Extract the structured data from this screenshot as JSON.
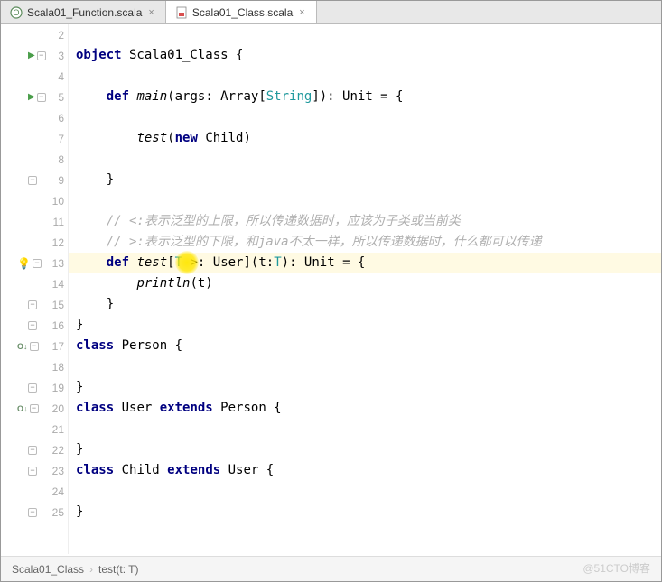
{
  "tabs": [
    {
      "label": "Scala01_Function.scala",
      "active": false
    },
    {
      "label": "Scala01_Class.scala",
      "active": true
    }
  ],
  "code": {
    "l2": "",
    "l3_kw": "object",
    "l3_name": " Scala01_Class {",
    "l4": "",
    "l5_kw1": "def",
    "l5_fn": " main",
    "l5_p1": "(args: Array[",
    "l5_type": "String",
    "l5_p2": "]): Unit = {",
    "l6": "",
    "l7_fn": "test",
    "l7_p1": "(",
    "l7_kw": "new",
    "l7_p2": " Child)",
    "l8": "",
    "l9": "}",
    "l10": "",
    "l11": "// <:表示泛型的上限，所以传递数据时，应该为子类或当前类",
    "l12": "// >:表示泛型的下限，和java不太一样，所以传递数据时，什么都可以传递",
    "l13_kw": "def",
    "l13_fn": " test",
    "l13_p1": "[",
    "l13_tp": "T",
    "l13_p2": " >: User](t:",
    "l13_tp2": "T",
    "l13_p3": "): Unit = {",
    "l14_fn": "println",
    "l14_arg": "(t)",
    "l15": "}",
    "l16": "}",
    "l17_kw": "class",
    "l17_name": " Person {",
    "l18": "",
    "l19": "}",
    "l20_kw": "class",
    "l20_name": " User ",
    "l20_kw2": "extends",
    "l20_sup": " Person {",
    "l21": "",
    "l22": "}",
    "l23_kw": "class",
    "l23_name": " Child ",
    "l23_kw2": "extends",
    "l23_sup": " User {",
    "l24": "",
    "l25": "}"
  },
  "line_numbers": [
    2,
    3,
    4,
    5,
    6,
    7,
    8,
    9,
    10,
    11,
    12,
    13,
    14,
    15,
    16,
    17,
    18,
    19,
    20,
    21,
    22,
    23,
    24,
    25
  ],
  "breadcrumb": {
    "item1": "Scala01_Class",
    "item2": "test(t: T)"
  },
  "watermark": "@51CTO博客"
}
